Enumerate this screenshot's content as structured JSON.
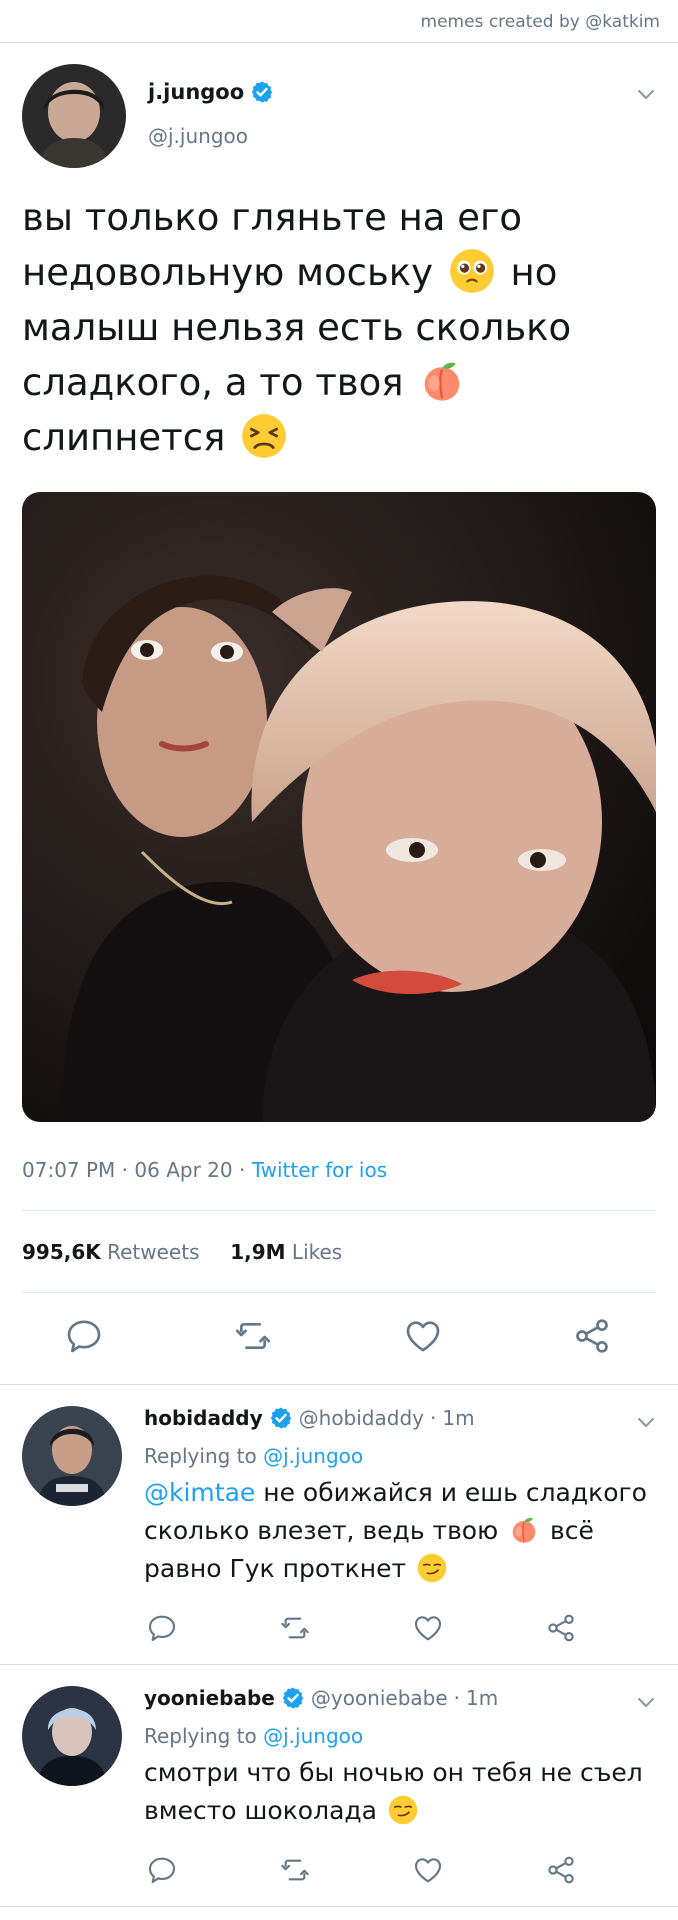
{
  "credit": "memes created by @katkim",
  "tweet": {
    "author_name": "j.jungoo",
    "author_handle": "@j.jungoo",
    "text_line1": "вы только гляньте на его",
    "text_line2": "недовольную моську",
    "text_line2_after": "но",
    "text_line3": "малыш нельзя есть сколько",
    "text_line4": "сладкого, а то твоя",
    "text_line5": "слипнется",
    "time": "07:07 PM",
    "date": "06 Apr 20",
    "source": "Twitter for ios",
    "retweets_count": "995,6K",
    "retweets_label": "Retweets",
    "likes_count": "1,9M",
    "likes_label": "Likes"
  },
  "replies": [
    {
      "name": "hobidaddy",
      "handle": "@hobidaddy",
      "time": "1m",
      "replying_label": "Replying to",
      "replying_to": "@j.jungoo",
      "mention": "@kimtae",
      "text_part1": "не обижайся и ешь сладкого",
      "text_part2": "сколько влезет, ведь твою",
      "text_part2_after": "всё",
      "text_part3": "равно Гук проткнет"
    },
    {
      "name": "yooniebabe",
      "handle": "@yooniebabe",
      "time": "1m",
      "replying_label": "Replying to",
      "replying_to": "@j.jungoo",
      "text_part1": "смотри что бы ночью он тебя не съел",
      "text_part2": "вместо шоколада"
    }
  ],
  "colors": {
    "accent": "#1da1f2",
    "muted": "#657786",
    "text": "#14171a",
    "divider": "#e1e8ed"
  },
  "icons": [
    "verified-badge-icon",
    "chevron-down-icon",
    "reply-icon",
    "retweet-icon",
    "like-icon",
    "share-icon",
    "pleading-face-emoji",
    "peach-emoji",
    "tired-face-emoji",
    "smirk-emoji"
  ]
}
